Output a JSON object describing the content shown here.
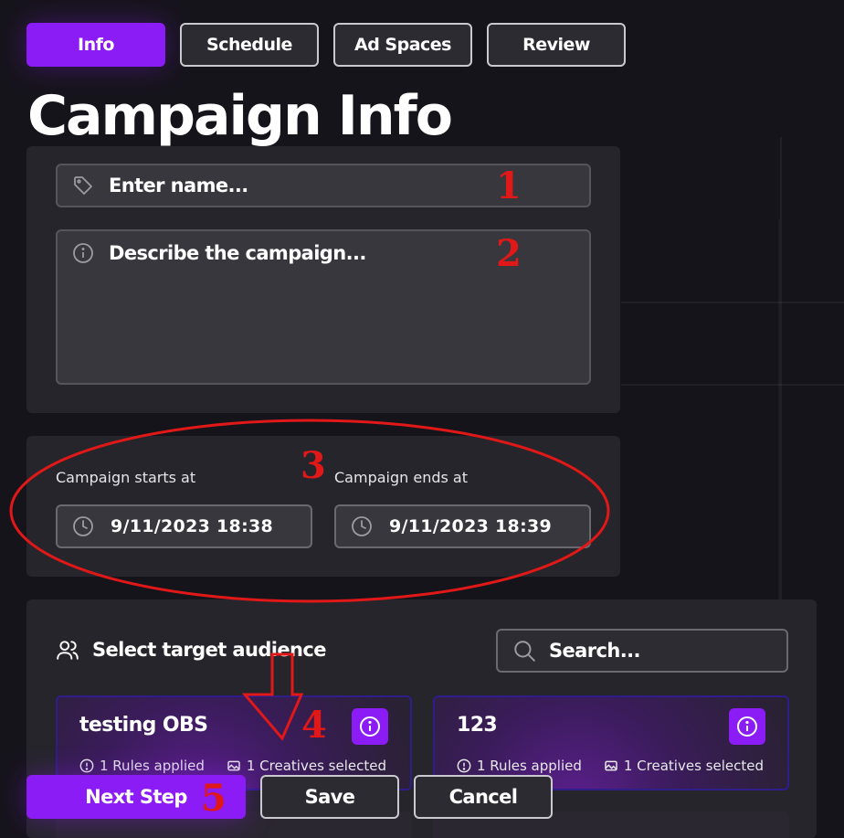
{
  "tabs": [
    {
      "label": "Info",
      "active": true
    },
    {
      "label": "Schedule",
      "active": false
    },
    {
      "label": "Ad Spaces",
      "active": false
    },
    {
      "label": "Review",
      "active": false
    }
  ],
  "page_title": "Campaign Info",
  "form": {
    "name_placeholder": "Enter name...",
    "description_placeholder": "Describe the campaign..."
  },
  "schedule": {
    "start_label": "Campaign starts at",
    "start_value": "9/11/2023 18:38",
    "end_label": "Campaign ends at",
    "end_value": "9/11/2023 18:39"
  },
  "audience": {
    "title": "Select target audience",
    "search_placeholder": "Search...",
    "items": [
      {
        "name": "testing OBS",
        "rules": "1 Rules applied",
        "creatives": "1 Creatives selected"
      },
      {
        "name": "123",
        "rules": "1 Rules applied",
        "creatives": "1 Creatives selected"
      }
    ]
  },
  "footer": {
    "next_label": "Next Step",
    "save_label": "Save",
    "cancel_label": "Cancel"
  },
  "annotations": [
    "1",
    "2",
    "3",
    "4",
    "5"
  ],
  "colors": {
    "accent": "#8b1cf5",
    "background": "#16141b",
    "card": "#26252b",
    "annotation": "#e01818"
  }
}
